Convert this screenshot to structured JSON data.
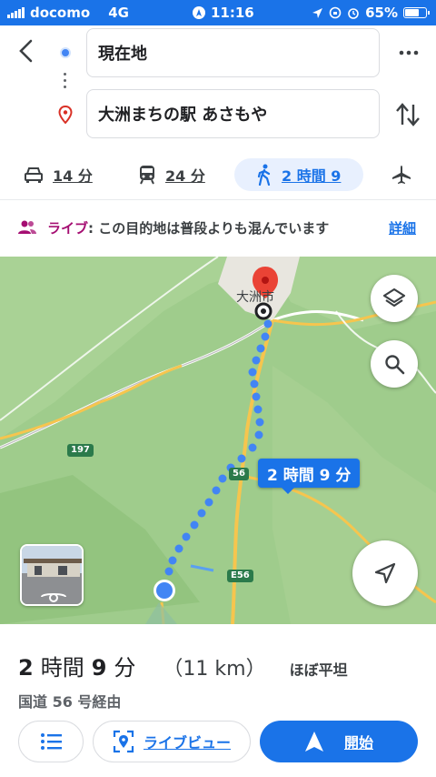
{
  "status_bar": {
    "carrier": "docomo",
    "network": "4G",
    "time": "11:16",
    "battery_percent": "65%"
  },
  "route": {
    "origin": "現在地",
    "destination": "大洲まちの駅 あさもや"
  },
  "modes": [
    {
      "name": "car",
      "label": "14 分"
    },
    {
      "name": "transit",
      "label": "24 分"
    },
    {
      "name": "walk",
      "label": "2 時間 9",
      "selected": true
    },
    {
      "name": "flight",
      "label": ""
    }
  ],
  "live_banner": {
    "label": "ライブ",
    "text": ": この目的地は普段よりも混んでいます",
    "detail": "詳細"
  },
  "map": {
    "duration_chip": "2 時間 9 分",
    "town_label": "大洲市",
    "route_labels": [
      "197",
      "56",
      "E56"
    ]
  },
  "summary": {
    "duration_hours": "2",
    "unit_hours": "時間",
    "duration_minutes": "9",
    "unit_minutes": "分",
    "distance": "（11 km）",
    "terrain": "ほぼ平坦",
    "via": "国道 56 号経由"
  },
  "buttons": {
    "live_view": "ライブビュー",
    "start": "開始"
  },
  "colors": {
    "accent": "#1a73e8",
    "live_label": "#a50e72",
    "map_green": "#9fcc8c"
  }
}
